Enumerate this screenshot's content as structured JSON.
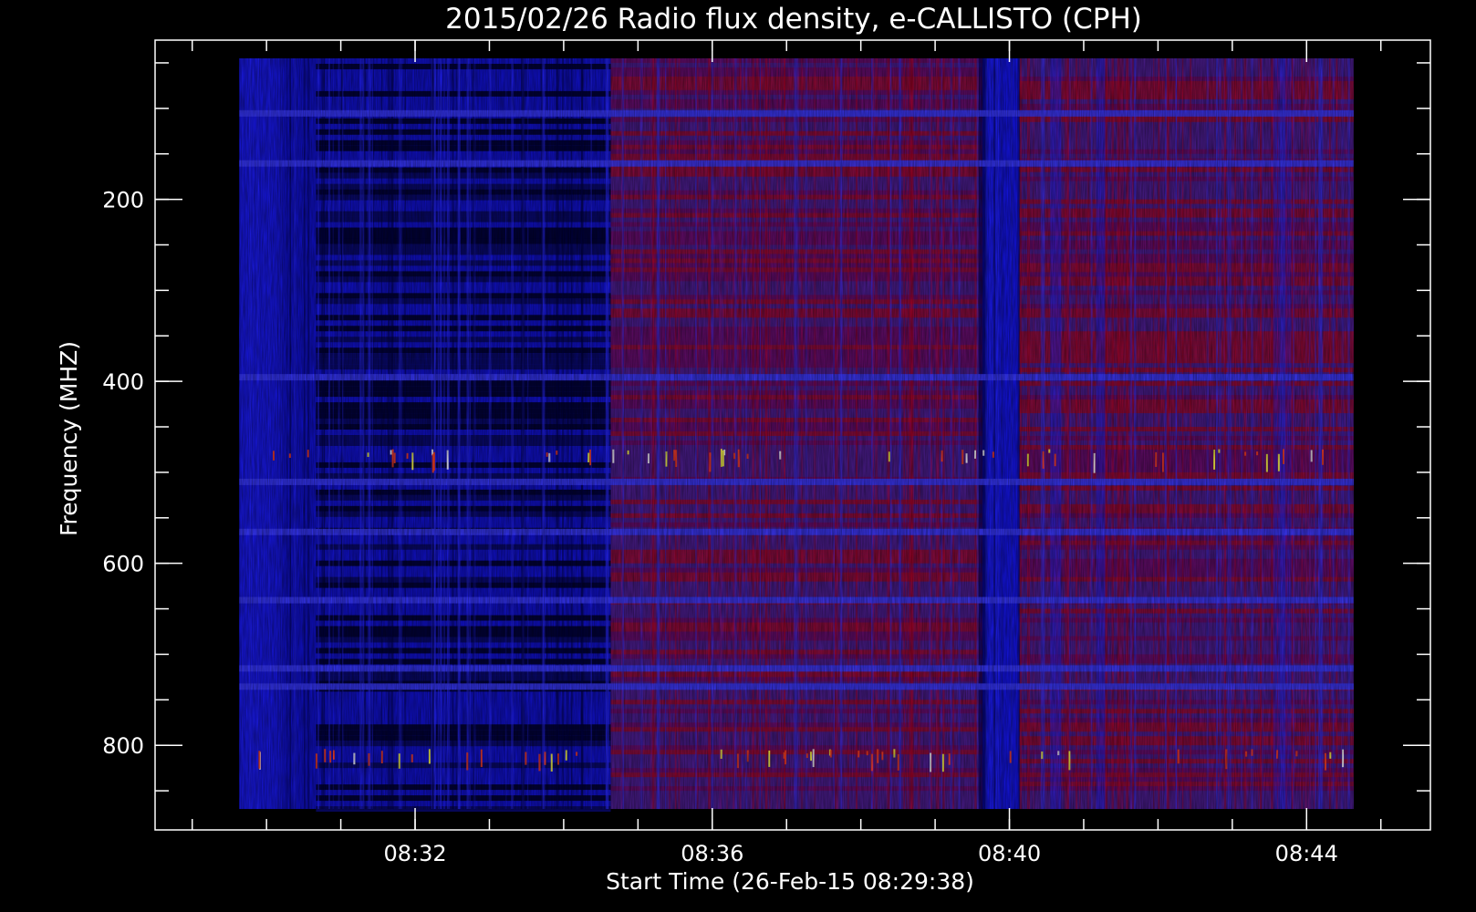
{
  "chart_data": {
    "type": "heatmap",
    "title": "2015/02/26  Radio flux density, e-CALLISTO (CPH)",
    "xlabel": "Start Time (26-Feb-15 08:29:38)",
    "ylabel": "Frequency (MHZ)",
    "x_unit": "UT time",
    "x_range": [
      "08:29:38",
      "08:44:38"
    ],
    "x_axis_range": [
      "08:28:30",
      "08:45:40"
    ],
    "x_major_ticks": [
      "08:32",
      "08:36",
      "08:40",
      "08:44"
    ],
    "x_minor_step_minutes": 1,
    "y_unit": "MHz",
    "y_range": [
      45,
      870
    ],
    "y_axis_range": [
      25,
      893
    ],
    "y_inverted": true,
    "y_major_ticks": [
      200,
      400,
      600,
      800
    ],
    "y_minor_step": 50,
    "grid": false,
    "colormap": [
      "#000000",
      "#0000ff",
      "#cc0000",
      "#ffff00",
      "#ffffff"
    ],
    "background": "#000000",
    "segments": [
      {
        "start": "08:29:38",
        "end": "08:34:38",
        "level": "low (black/blue)"
      },
      {
        "start": "08:34:38",
        "end": "08:39:38",
        "level": "elevated (red/purple)"
      },
      {
        "start": "08:39:38",
        "end": "08:40:08",
        "level": "low (blue)"
      },
      {
        "start": "08:40:08",
        "end": "08:44:38",
        "level": "elevated (red/purple)"
      }
    ],
    "bright_bands_mhz": [
      480,
      810
    ],
    "interference_lines_mhz": [
      105,
      160,
      395,
      510,
      565,
      640,
      715,
      735
    ]
  }
}
